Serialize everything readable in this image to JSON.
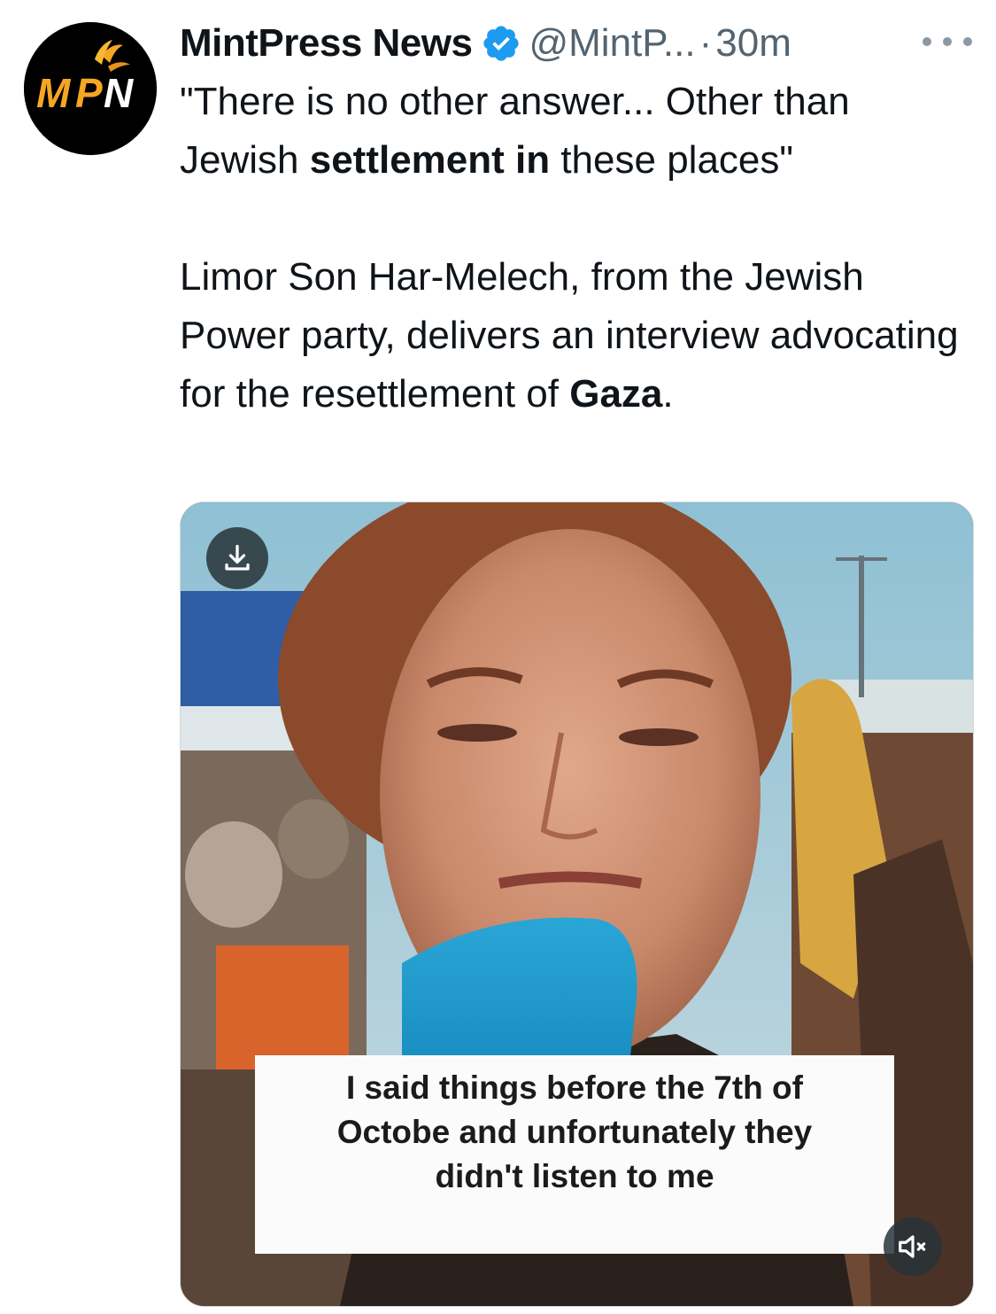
{
  "account": {
    "avatar_text": "MPN",
    "display_name": "MintPress News",
    "handle": "@MintP...",
    "separator": "·",
    "timestamp": "30m",
    "verified_icon": "verified-badge-icon",
    "verified_color": "#1d9bf0"
  },
  "tweet": {
    "quote_part1": "\"There is no other answer... Other than Jewish ",
    "quote_bold": "settlement in",
    "quote_part2": " these places\"",
    "body_part1": "Limor Son Har-Melech, from the Jewish Power party, delivers an interview advocating for the resettlement of ",
    "body_bold": "Gaza",
    "body_part2": "."
  },
  "media": {
    "caption_line1": "I said things before the 7th of",
    "caption_line2": "Octobe and unfortunately they",
    "caption_line3": "didn't listen to me",
    "download_icon": "download-icon",
    "mute_icon": "muted-speaker-icon"
  },
  "colors": {
    "text_primary": "#0f1419",
    "text_secondary": "#536471",
    "logo_orange": "#f5a623"
  }
}
